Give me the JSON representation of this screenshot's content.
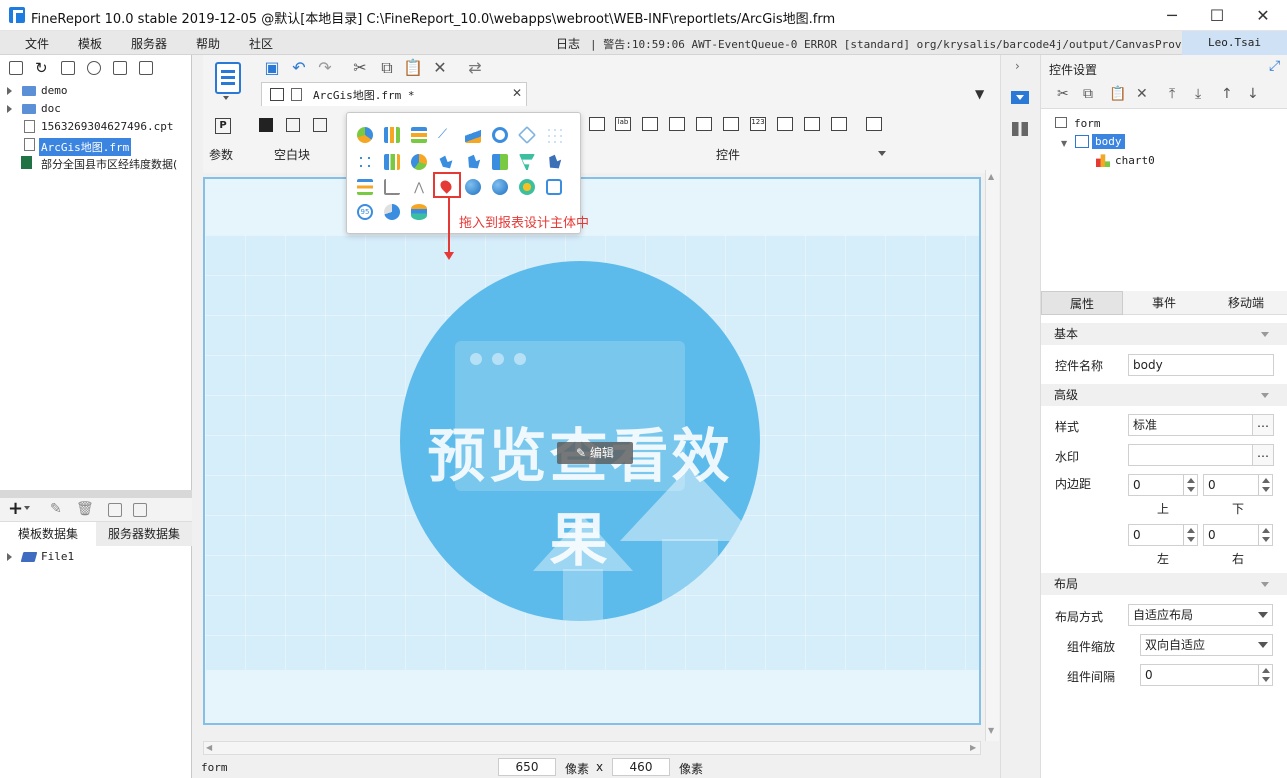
{
  "window": {
    "title": "FineReport 10.0 stable 2019-12-05 @默认[本地目录]    C:\\FineReport_10.0\\webapps\\webroot\\WEB-INF\\reportlets/ArcGis地图.frm"
  },
  "menu": {
    "items": [
      "文件",
      "模板",
      "服务器",
      "帮助",
      "社区"
    ],
    "log_label": "日志",
    "log_text": "| 警告:10:59:06 AWT-EventQueue-0 ERROR [standard] org/krysalis/barcode4j/output/CanvasProvider",
    "user": "Leo.Tsai"
  },
  "file_tree": {
    "items": [
      {
        "label": "demo",
        "type": "folder"
      },
      {
        "label": "doc",
        "type": "folder"
      },
      {
        "label": "1563269304627496.cpt",
        "type": "file"
      },
      {
        "label": "ArcGis地图.frm",
        "type": "file",
        "selected": true
      },
      {
        "label": "部分全国县市区经纬度数据(",
        "type": "excel"
      }
    ]
  },
  "dataset_tabs": {
    "template": "模板数据集",
    "server": "服务器数据集",
    "items": [
      "File1"
    ]
  },
  "editor": {
    "tab_label": "ArcGis地图.frm *",
    "groups": {
      "param": "参数",
      "blank": "空白块",
      "widget": "控件"
    },
    "hint": "拖入到报表设计主体中",
    "preview_text": "预览查看效果",
    "edit_button": "编辑",
    "status_left": "form",
    "width": "650",
    "height": "460",
    "unit": "像素",
    "times": "x"
  },
  "right_panel": {
    "title": "控件设置",
    "tree": {
      "root": "form",
      "body": "body",
      "child": "chart0"
    },
    "tabs": [
      "属性",
      "事件",
      "移动端"
    ],
    "sections": {
      "basic": "基本",
      "advanced": "高级",
      "layout": "布局"
    },
    "props": {
      "name_label": "控件名称",
      "name_value": "body",
      "style_label": "样式",
      "style_value": "标准",
      "watermark_label": "水印",
      "padding_label": "内边距",
      "pad_top": "0",
      "pad_bottom": "0",
      "pad_left": "0",
      "pad_right": "0",
      "top": "上",
      "bottom": "下",
      "left": "左",
      "right": "右",
      "layout_mode_label": "布局方式",
      "layout_mode_value": "自适应布局",
      "scale_label": "组件缩放",
      "scale_value": "双向自适应",
      "gap_label": "组件间隔",
      "gap_value": "0"
    }
  },
  "colors": {
    "accent": "#2b79d6",
    "hint": "#e53935",
    "canvas": "#e6f4fc",
    "preview_circle": "#5cbbea"
  }
}
